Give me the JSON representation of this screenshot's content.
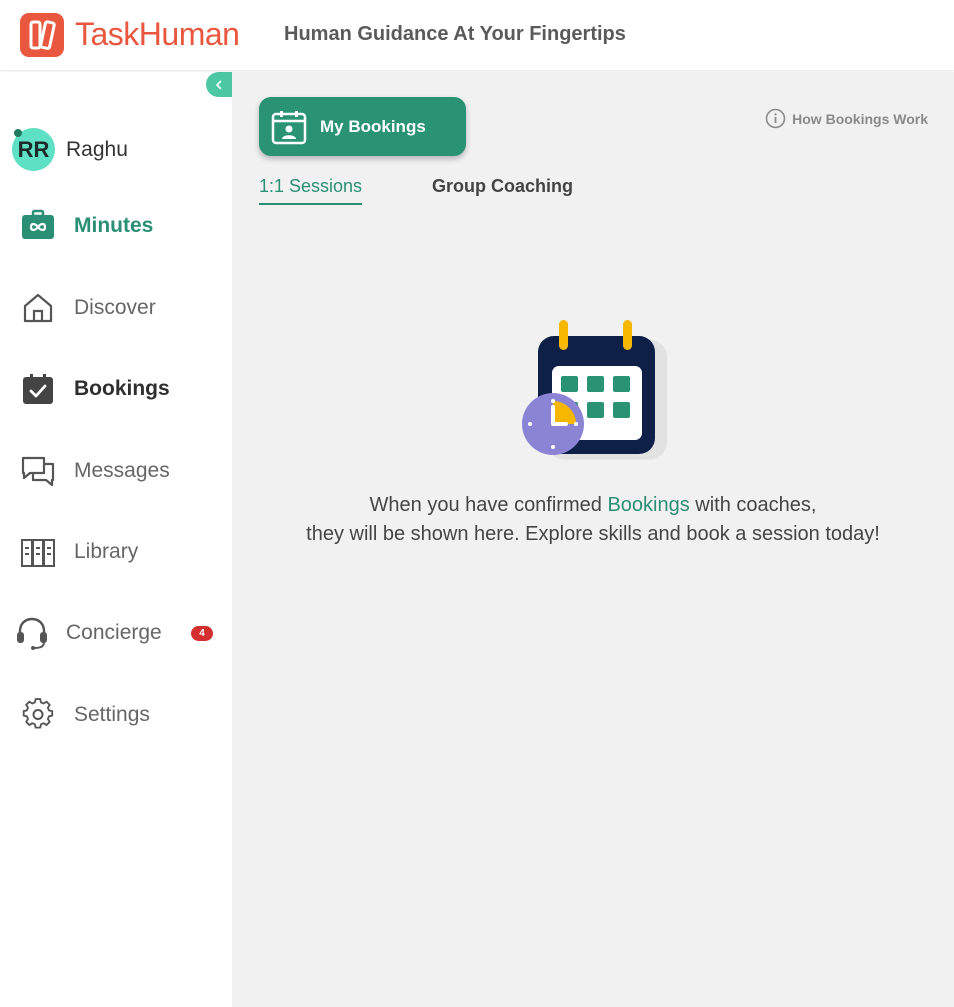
{
  "header": {
    "brand": "TaskHuman",
    "tagline": "Human Guidance At Your Fingertips"
  },
  "sidebar": {
    "user": {
      "initials": "RR",
      "name": "Raghu"
    },
    "items": [
      {
        "label": "Minutes",
        "icon": "minutes-icon"
      },
      {
        "label": "Discover",
        "icon": "home-icon"
      },
      {
        "label": "Bookings",
        "icon": "calendar-check-icon"
      },
      {
        "label": "Messages",
        "icon": "chat-bubbles-icon"
      },
      {
        "label": "Library",
        "icon": "library-icon"
      },
      {
        "label": "Concierge",
        "icon": "headset-icon",
        "badge": "4"
      },
      {
        "label": "Settings",
        "icon": "gear-icon"
      }
    ]
  },
  "main": {
    "title_button": "My Bookings",
    "help_link": "How Bookings Work",
    "tabs": [
      "1:1 Sessions",
      "Group Coaching"
    ],
    "active_tab": "1:1 Sessions",
    "empty_state": {
      "line1_prefix": "When you have confirmed ",
      "line1_highlight": "Bookings",
      "line1_suffix": " with coaches,",
      "line2": "they will be shown here. Explore skills and book a session today!"
    }
  },
  "colors": {
    "brand": "#e9573f",
    "accent": "#2a9373",
    "badge": "#d32f2f"
  }
}
